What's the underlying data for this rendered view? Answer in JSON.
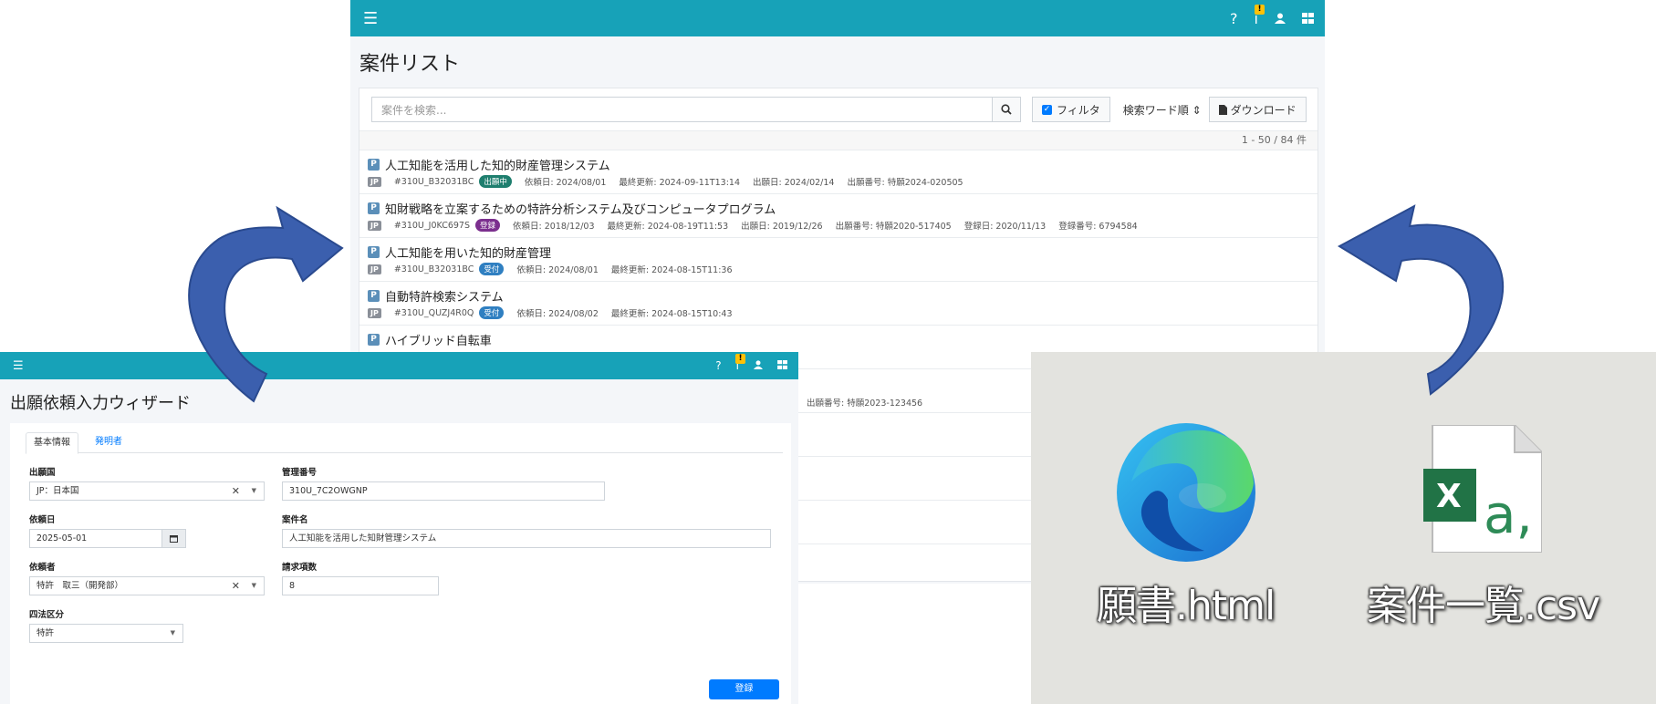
{
  "list_window": {
    "title": "案件リスト",
    "search_placeholder": "案件を検索...",
    "filter_label": "フィルタ",
    "sort_label": "検索ワード順",
    "download_label": "ダウンロード",
    "count_label": "1 - 50 / 84 件",
    "items": [
      {
        "title": "人工知能を活用した知的財産管理システム",
        "country": "JP",
        "id": "#310U_B32031BC",
        "status": "出願中",
        "status_color": "#1e7e6e",
        "meta": [
          "依頼日: 2024/08/01",
          "最終更新: 2024-09-11T13:14",
          "出願日: 2024/02/14",
          "出願番号: 特願2024-020505"
        ]
      },
      {
        "title": "知財戦略を立案するための特許分析システム及びコンピュータプログラム",
        "country": "JP",
        "id": "#310U_J0KC697S",
        "status": "登録",
        "status_color": "#7b2f8e",
        "meta": [
          "依頼日: 2018/12/03",
          "最終更新: 2024-08-19T11:53",
          "出願日: 2019/12/26",
          "出願番号: 特願2020-517405",
          "登録日: 2020/11/13",
          "登録番号: 6794584"
        ]
      },
      {
        "title": "人工知能を用いた知的財産管理",
        "country": "JP",
        "id": "#310U_B32031BC",
        "status": "受付",
        "status_color": "#2f7fc1",
        "meta": [
          "依頼日: 2024/08/01",
          "最終更新: 2024-08-15T11:36"
        ]
      },
      {
        "title": "自動特許検索システム",
        "country": "JP",
        "id": "#310U_QUZJ4R0Q",
        "status": "受付",
        "status_color": "#2f7fc1",
        "meta": [
          "依頼日: 2024/08/02",
          "最終更新: 2024-08-15T10:43"
        ]
      },
      {
        "title": "ハイブリッド自転車"
      }
    ],
    "hidden_meta": "出願番号: 特願2023-123456"
  },
  "wizard_window": {
    "title": "出願依頼入力ウィザード",
    "tabs": [
      "基本情報",
      "発明者"
    ],
    "labels": {
      "country": "出願国",
      "mgmt_no": "管理番号",
      "request_date": "依頼日",
      "case_name": "案件名",
      "requester": "依頼者",
      "claims": "請求項数",
      "category": "四法区分"
    },
    "values": {
      "country": "JP：日本国",
      "mgmt_no": "310U_7C2OWGNP",
      "request_date": "2025-05-01",
      "case_name": "人工知能を活用した知財管理システム",
      "requester": "特許　取三（開発部）",
      "claims": "8",
      "category": "特許"
    },
    "submit_label": "登録"
  },
  "desktop": {
    "file1": "願書.html",
    "file2": "案件一覧.csv"
  },
  "colors": {
    "header": "#17a2b8",
    "arrow": "#3b5fae",
    "primary": "#007bff"
  }
}
